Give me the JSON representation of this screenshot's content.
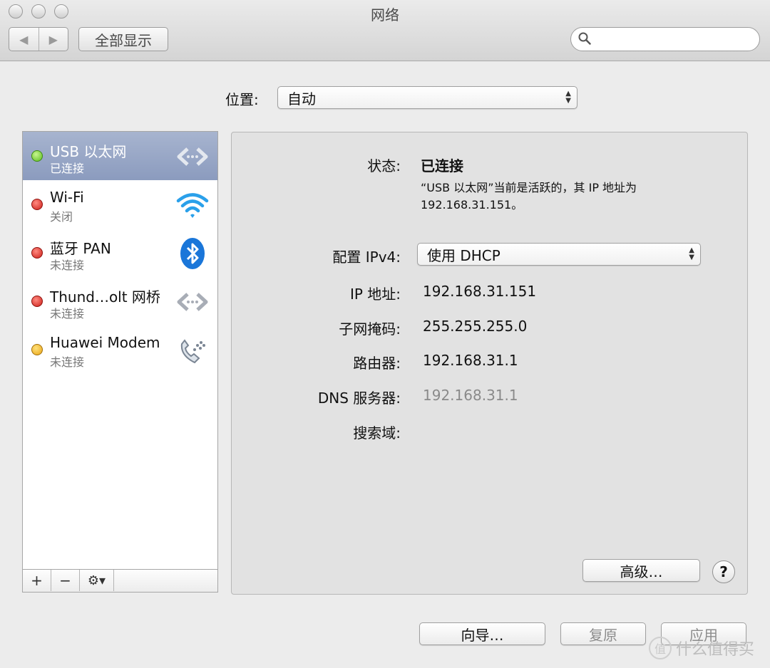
{
  "window": {
    "title": "网络"
  },
  "toolbar": {
    "back_label": "◀",
    "forward_label": "▶",
    "show_all_label": "全部显示",
    "search_placeholder": ""
  },
  "location": {
    "label": "位置:",
    "value": "自动"
  },
  "services": [
    {
      "name": "USB 以太网",
      "status": "已连接",
      "dot_color": "#6ac62a",
      "icon": "ethernet-icon",
      "selected": true
    },
    {
      "name": "Wi-Fi",
      "status": "关闭",
      "dot_color": "#d8231e",
      "icon": "wifi-icon",
      "selected": false
    },
    {
      "name": "蓝牙 PAN",
      "status": "未连接",
      "dot_color": "#d8231e",
      "icon": "bluetooth-icon",
      "selected": false
    },
    {
      "name": "Thund…olt 网桥",
      "status": "未连接",
      "dot_color": "#d8231e",
      "icon": "thunderbolt-bridge-icon",
      "selected": false
    },
    {
      "name": "Huawei Modem",
      "status": "未连接",
      "dot_color": "#f0b12a",
      "icon": "modem-phone-icon",
      "selected": false
    }
  ],
  "list_toolbar": {
    "add": "+",
    "remove": "−",
    "gear": "⚙▾"
  },
  "detail": {
    "status_label": "状态:",
    "status_value": "已连接",
    "status_desc_line1": "“USB 以太网”当前是活跃的，其 IP 地址为",
    "status_desc_line2": "192.168.31.151。",
    "ipv4_label": "配置 IPv4:",
    "ipv4_value": "使用 DHCP",
    "ip_label": "IP 地址:",
    "ip_value": "192.168.31.151",
    "mask_label": "子网掩码:",
    "mask_value": "255.255.255.0",
    "router_label": "路由器:",
    "router_value": "192.168.31.1",
    "dns_label": "DNS 服务器:",
    "dns_value": "192.168.31.1",
    "search_domain_label": "搜索域:",
    "advanced_label": "高级…",
    "help_label": "?"
  },
  "footer": {
    "assist_label": "向导…",
    "revert_label": "复原",
    "apply_label": "应用"
  },
  "watermark": {
    "text": "什么值得买",
    "logo": "值"
  },
  "colors": {
    "selection": "#8b9bbe",
    "connected": "#6ac62a",
    "off": "#d8231e",
    "idle": "#f0b12a"
  }
}
